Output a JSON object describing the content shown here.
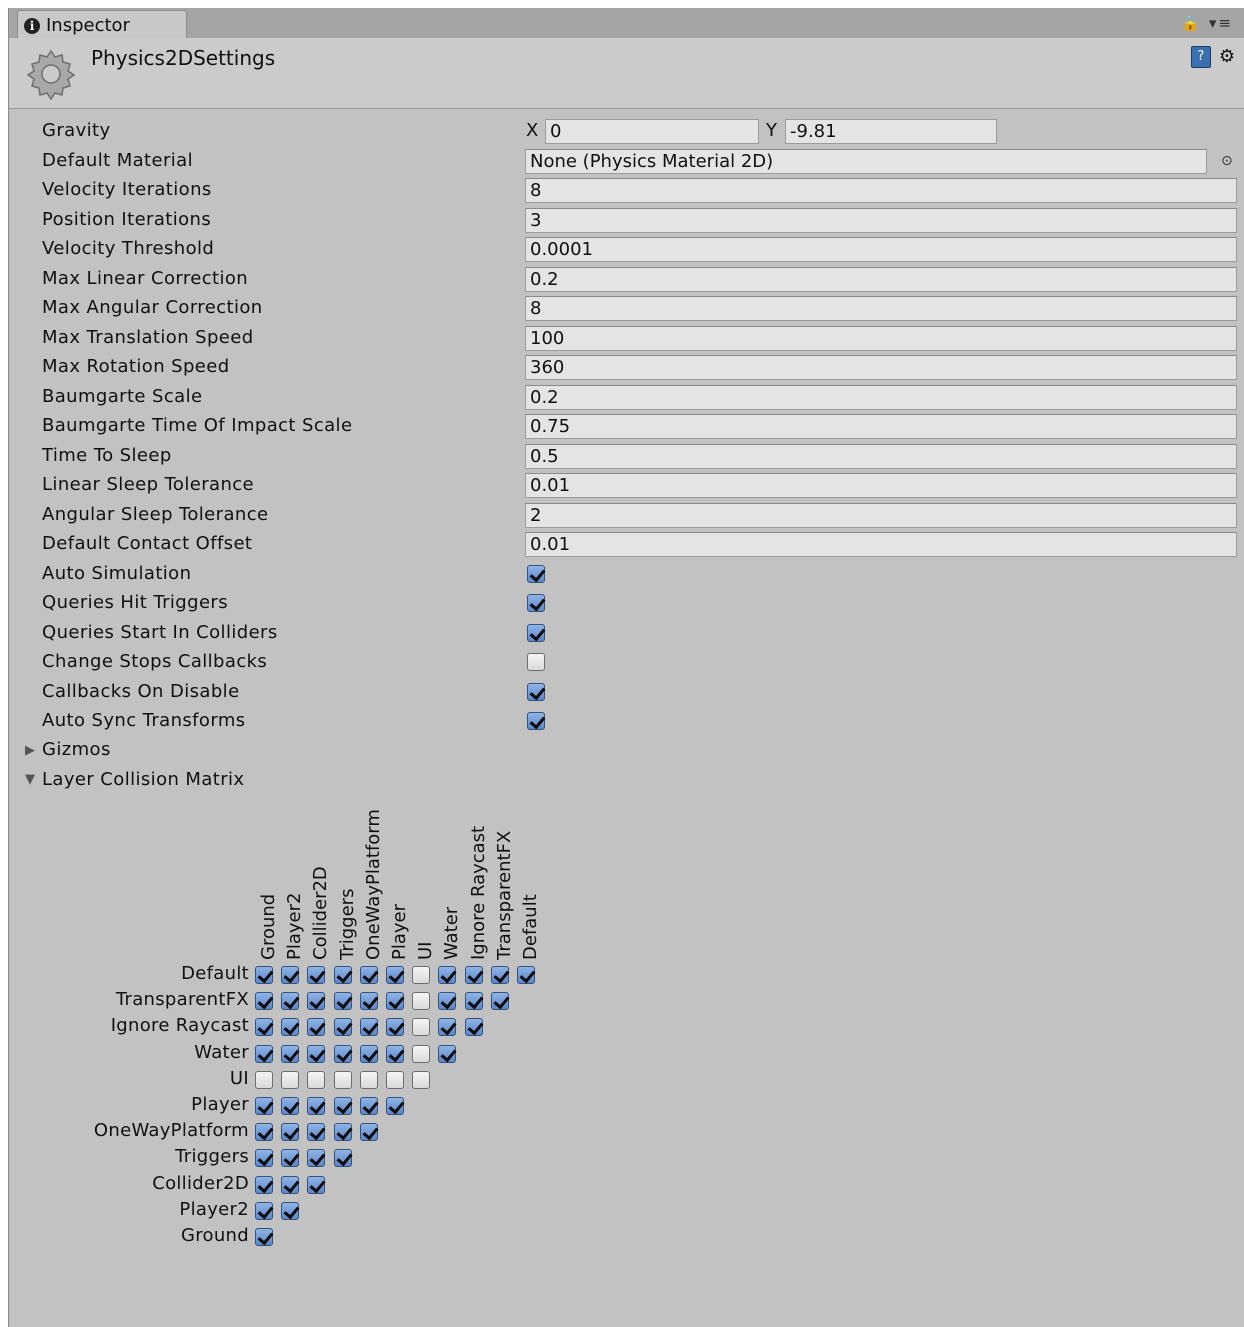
{
  "tab": {
    "label": "Inspector"
  },
  "header": {
    "title": "Physics2DSettings"
  },
  "gravity": {
    "label": "Gravity",
    "x_label": "X",
    "x": "0",
    "y_label": "Y",
    "y": "-9.81"
  },
  "default_material": {
    "label": "Default Material",
    "value": "None (Physics Material 2D)"
  },
  "fields": [
    {
      "label": "Velocity Iterations",
      "value": "8"
    },
    {
      "label": "Position Iterations",
      "value": "3"
    },
    {
      "label": "Velocity Threshold",
      "value": "0.0001"
    },
    {
      "label": "Max Linear Correction",
      "value": "0.2"
    },
    {
      "label": "Max Angular Correction",
      "value": "8"
    },
    {
      "label": "Max Translation Speed",
      "value": "100"
    },
    {
      "label": "Max Rotation Speed",
      "value": "360"
    },
    {
      "label": "Baumgarte Scale",
      "value": "0.2"
    },
    {
      "label": "Baumgarte Time Of Impact Scale",
      "value": "0.75"
    },
    {
      "label": "Time To Sleep",
      "value": "0.5"
    },
    {
      "label": "Linear Sleep Tolerance",
      "value": "0.01"
    },
    {
      "label": "Angular Sleep Tolerance",
      "value": "2"
    },
    {
      "label": "Default Contact Offset",
      "value": "0.01"
    }
  ],
  "toggles": [
    {
      "label": "Auto Simulation",
      "checked": true
    },
    {
      "label": "Queries Hit Triggers",
      "checked": true
    },
    {
      "label": "Queries Start In Colliders",
      "checked": true
    },
    {
      "label": "Change Stops Callbacks",
      "checked": false
    },
    {
      "label": "Callbacks On Disable",
      "checked": true
    },
    {
      "label": "Auto Sync Transforms",
      "checked": true
    }
  ],
  "gizmos": {
    "label": "Gizmos"
  },
  "matrix_section": {
    "label": "Layer Collision Matrix"
  },
  "matrix": {
    "columns": [
      "Ground",
      "Player2",
      "Collider2D",
      "Triggers",
      "OneWayPlatform",
      "Player",
      "UI",
      "Water",
      "Ignore Raycast",
      "TransparentFX",
      "Default"
    ],
    "rows": [
      {
        "label": "Default",
        "values": [
          true,
          true,
          true,
          true,
          true,
          true,
          false,
          true,
          true,
          true,
          true
        ]
      },
      {
        "label": "TransparentFX",
        "values": [
          true,
          true,
          true,
          true,
          true,
          true,
          false,
          true,
          true,
          true
        ]
      },
      {
        "label": "Ignore Raycast",
        "values": [
          true,
          true,
          true,
          true,
          true,
          true,
          false,
          true,
          true
        ]
      },
      {
        "label": "Water",
        "values": [
          true,
          true,
          true,
          true,
          true,
          true,
          false,
          true
        ]
      },
      {
        "label": "UI",
        "values": [
          false,
          false,
          false,
          false,
          false,
          false,
          false
        ]
      },
      {
        "label": "Player",
        "values": [
          true,
          true,
          true,
          true,
          true,
          true
        ]
      },
      {
        "label": "OneWayPlatform",
        "values": [
          true,
          true,
          true,
          true,
          true
        ]
      },
      {
        "label": "Triggers",
        "values": [
          true,
          true,
          true,
          true
        ]
      },
      {
        "label": "Collider2D",
        "values": [
          true,
          true,
          true
        ]
      },
      {
        "label": "Player2",
        "values": [
          true,
          true
        ]
      },
      {
        "label": "Ground",
        "values": [
          true
        ]
      }
    ]
  }
}
